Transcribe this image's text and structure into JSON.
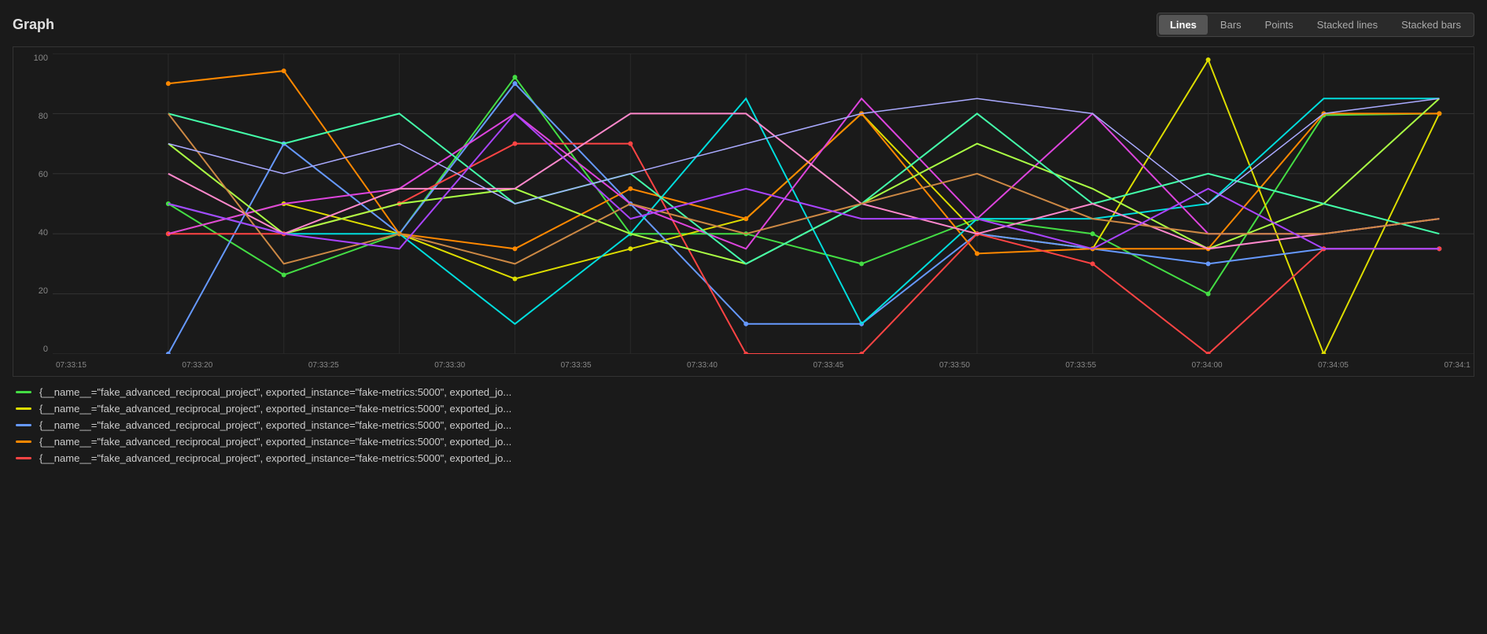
{
  "header": {
    "title": "Graph"
  },
  "toolbar": {
    "buttons": [
      {
        "label": "Lines",
        "active": true
      },
      {
        "label": "Bars",
        "active": false
      },
      {
        "label": "Points",
        "active": false
      },
      {
        "label": "Stacked lines",
        "active": false
      },
      {
        "label": "Stacked bars",
        "active": false
      }
    ]
  },
  "chart": {
    "y_labels": [
      "100",
      "80",
      "60",
      "40",
      "20",
      "0"
    ],
    "x_labels": [
      "07:33:15",
      "07:33:20",
      "07:33:25",
      "07:33:30",
      "07:33:35",
      "07:33:40",
      "07:33:45",
      "07:33:50",
      "07:33:55",
      "07:34:00",
      "07:34:05",
      "07:34:1"
    ]
  },
  "legend": [
    {
      "color": "#44dd44",
      "text": "{__name__=\"fake_advanced_reciprocal_project\", exported_instance=\"fake-metrics:5000\", exported_jo..."
    },
    {
      "color": "#dddd00",
      "text": "{__name__=\"fake_advanced_reciprocal_project\", exported_instance=\"fake-metrics:5000\", exported_jo..."
    },
    {
      "color": "#6699ff",
      "text": "{__name__=\"fake_advanced_reciprocal_project\", exported_instance=\"fake-metrics:5000\", exported_jo..."
    },
    {
      "color": "#ff8800",
      "text": "{__name__=\"fake_advanced_reciprocal_project\", exported_instance=\"fake-metrics:5000\", exported_jo..."
    },
    {
      "color": "#ff4444",
      "text": "{__name__=\"fake_advanced_reciprocal_project\", exported_instance=\"fake-metrics:5000\", exported_jo..."
    }
  ]
}
